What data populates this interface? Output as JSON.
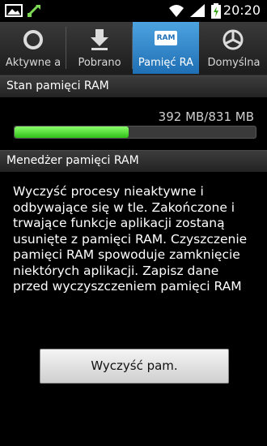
{
  "status_bar": {
    "time": "20:20"
  },
  "tabs": [
    {
      "label": "Aktywne a",
      "icon": "circle-icon",
      "active": false
    },
    {
      "label": "Pobrano",
      "icon": "download-arrow-icon",
      "active": false
    },
    {
      "label": "Pamięć RA",
      "icon": "ram-chip-icon",
      "icon_text": "RAM",
      "active": true
    },
    {
      "label": "Domyślna",
      "icon": "pie-chart-icon",
      "active": false
    }
  ],
  "ram_section": {
    "header": "Stan pamięci RAM",
    "usage_text": "392 MB/831 MB",
    "used_mb": 392,
    "total_mb": 831
  },
  "manager_section": {
    "header": "Menedżer pamięci RAM",
    "description": "Wyczyść procesy nieaktywne i odbywające się w tle. Zakończone i trwające funkcje aplikacji zostaną usunięte z pamięci RAM. Czyszczenie pamięci RAM spowoduje zamknięcie niektórych aplikacji. Zapisz dane przed wyczyszczeniem pamięci RAM",
    "clear_button": "Wyczyść pam."
  },
  "colors": {
    "accent_tab": "#2f86cc",
    "progress": "#3fd21f"
  }
}
